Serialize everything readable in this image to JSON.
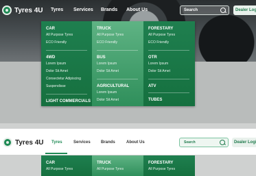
{
  "brand": {
    "name": "Tyres 4U"
  },
  "nav": {
    "tyres": "Tyres",
    "services": "Services",
    "brands": "Brands",
    "about": "About Us"
  },
  "search": {
    "placeholder": "Search"
  },
  "dealer": {
    "label": "Dealer Login"
  },
  "menu": {
    "col1": {
      "car": {
        "title": "CAR",
        "items": [
          "All Purpose Tyres",
          "ECO Friendly"
        ]
      },
      "fourwd": {
        "title": "4WD",
        "items": [
          "Lorem Ipsum",
          "Dolor Sit Amet",
          "Consectetur Adipiscing",
          "Suspendisse"
        ]
      },
      "light_commercials": {
        "title": "LIGHT COMMERCIALS"
      }
    },
    "col2": {
      "truck": {
        "title": "TRUCK",
        "items": [
          "All Purpose Tyres",
          "ECO Friendly"
        ]
      },
      "bus": {
        "title": "BUS",
        "items": [
          "Lorem Ipsum",
          "Dolor Sit Amet"
        ]
      },
      "agricultural": {
        "title": "AGRICULTURAL",
        "items": [
          "Lorem Ipsum",
          "Dolor Sit Amet"
        ]
      }
    },
    "col3": {
      "forestary": {
        "title": "FORESTARY",
        "items": [
          "All Purpose Tyres",
          "ECO Friendly"
        ]
      },
      "otr": {
        "title": "OTR",
        "items": [
          "Lorem Ipsum",
          "Dolor Sit Amet"
        ]
      },
      "atv": {
        "title": "ATV"
      },
      "tubes": {
        "title": "TUBES"
      }
    }
  },
  "colors": {
    "accent": "#1f8a55",
    "menu_dark": "#1a7747",
    "menu_light": "#4aa470"
  }
}
